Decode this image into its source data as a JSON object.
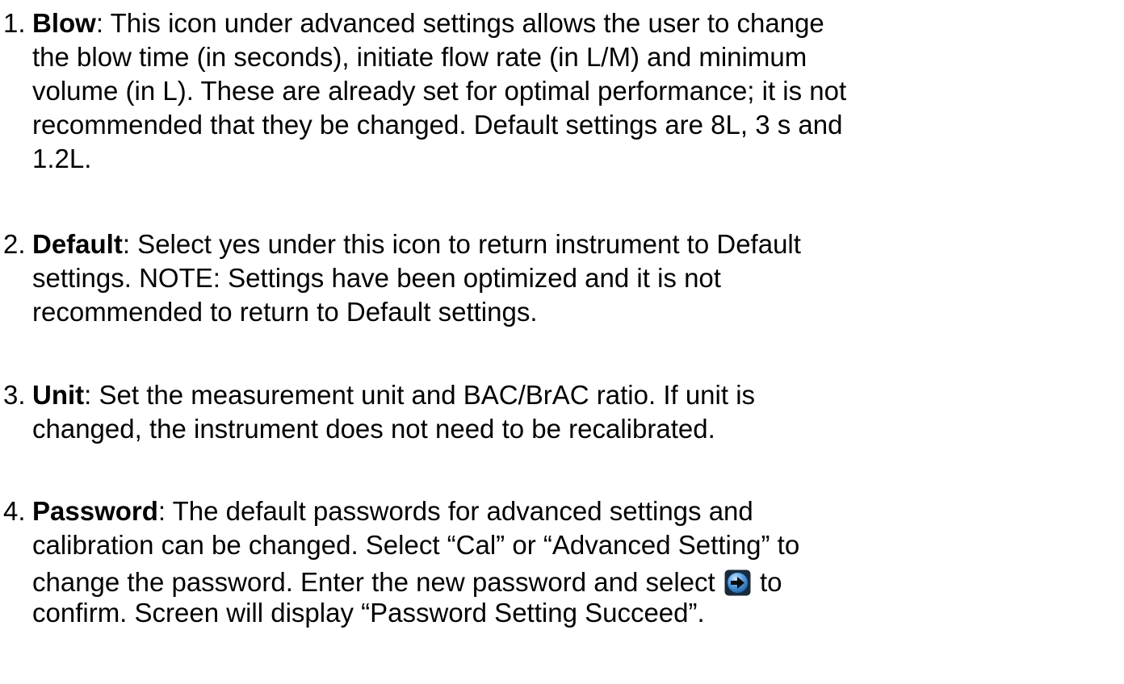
{
  "items": [
    {
      "number": "1.",
      "term": "Blow",
      "lines": [
        ":  This icon under advanced settings allows the user to change",
        "the blow time (in seconds), initiate flow rate (in L/M) and minimum",
        "volume (in L).  These are already set for optimal performance; it is not",
        "recommended that they be changed.  Default settings are 8L, 3 s and",
        "1.2L."
      ]
    },
    {
      "number": "2.",
      "term": "Default",
      "lines": [
        ":  Select yes under this icon to return instrument to Default",
        "settings.  NOTE: Settings have been optimized and it is not",
        "recommended to return to Default settings."
      ]
    },
    {
      "number": "3.",
      "term": "Unit",
      "lines": [
        ":  Set the measurement unit and BAC/BrAC ratio.  If unit is",
        "changed, the instrument does not need to be recalibrated."
      ]
    },
    {
      "number": "4.",
      "term": "Password",
      "lines": [
        ":  The default passwords for advanced settings and",
        "calibration can be changed.  Select “Cal” or “Advanced Setting” to",
        "change the password.  Enter the new password and select ",
        " to",
        "confirm.  Screen will display “Password Setting Succeed”."
      ]
    }
  ],
  "icons": {
    "confirm_arrow": "arrow-right-circle-icon",
    "confirm_arrow_color": "#2a6fb5"
  }
}
